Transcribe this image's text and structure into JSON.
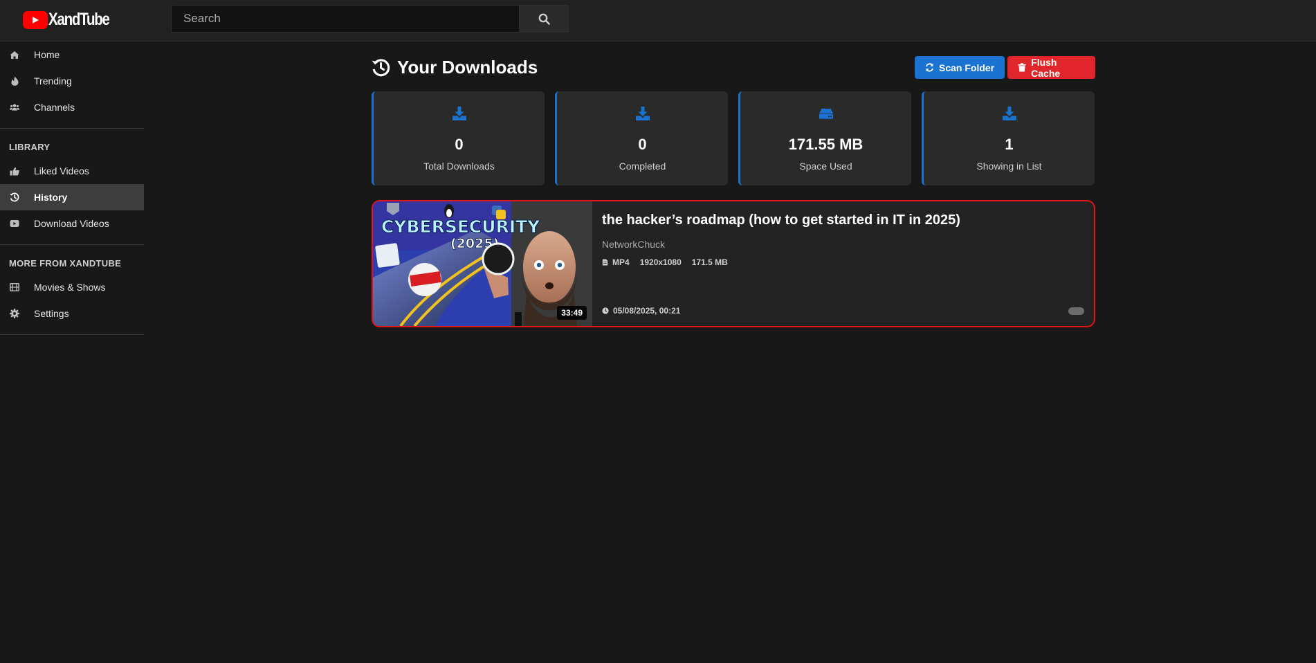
{
  "app": {
    "name": "XandTube"
  },
  "search": {
    "placeholder": "Search"
  },
  "sidebar": {
    "items": [
      {
        "label": "Home"
      },
      {
        "label": "Trending"
      },
      {
        "label": "Channels"
      }
    ],
    "library_heading": "LIBRARY",
    "library_items": [
      {
        "label": "Liked Videos"
      },
      {
        "label": "History"
      },
      {
        "label": "Download Videos"
      }
    ],
    "more_heading": "MORE FROM XANDTUBE",
    "more_items": [
      {
        "label": "Movies & Shows"
      },
      {
        "label": "Settings"
      }
    ]
  },
  "page": {
    "title": "Your Downloads",
    "scan_label": "Scan Folder",
    "flush_label": "Flush Cache"
  },
  "stats": [
    {
      "value": "0",
      "label": "Total Downloads",
      "icon": "download-icon"
    },
    {
      "value": "0",
      "label": "Completed",
      "icon": "download-icon"
    },
    {
      "value": "171.55 MB",
      "label": "Space Used",
      "icon": "hdd-icon"
    },
    {
      "value": "1",
      "label": "Showing in List",
      "icon": "download-icon"
    }
  ],
  "video": {
    "title": "the hacker’s roadmap (how to get started in IT in 2025)",
    "channel": "NetworkChuck",
    "format": "MP4",
    "resolution": "1920x1080",
    "size": "171.5 MB",
    "date": "05/08/2025, 00:21",
    "duration": "33:49",
    "thumb_text_1": "CYBERSECURITY",
    "thumb_text_2": "(2025)"
  },
  "colors": {
    "accent": "#1a73d1",
    "danger": "#e0262a",
    "brand": "#ff0000"
  }
}
